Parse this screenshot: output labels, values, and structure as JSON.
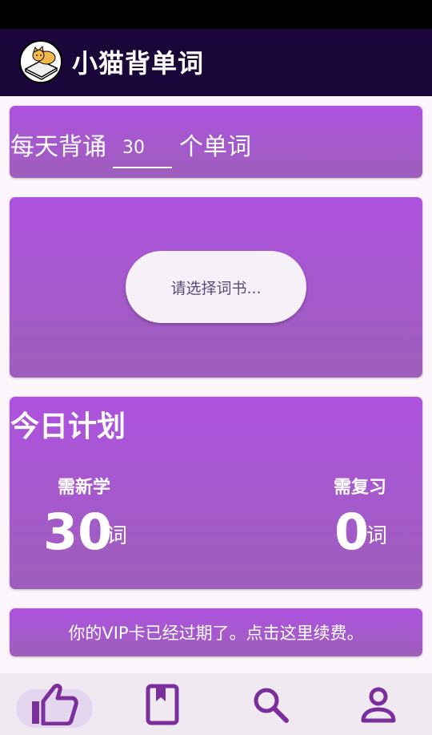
{
  "app": {
    "title": "小猫背单词"
  },
  "daily": {
    "prefix": "每天背诵",
    "count": "30",
    "suffix": "个单词"
  },
  "wordbook": {
    "button_label": "请选择词书..."
  },
  "plan": {
    "title": "今日计划",
    "new_label": "需新学",
    "new_count": "30",
    "new_unit": "词",
    "review_label": "需复习",
    "review_count": "0",
    "review_unit": "词"
  },
  "vip": {
    "text": "你的VIP卡已经过期了。点击这里续费。"
  },
  "nav": {
    "items": [
      {
        "icon": "thumb-up-icon",
        "active": true
      },
      {
        "icon": "book-icon",
        "active": false
      },
      {
        "icon": "search-icon",
        "active": false
      },
      {
        "icon": "person-icon",
        "active": false
      }
    ]
  },
  "colors": {
    "app_bar": "#1a0638",
    "card_top": "#ad52df",
    "card_bottom": "#9e5fbb",
    "nav_icon": "#7a2f9c",
    "nav_active_pill": "#e5d6f0"
  }
}
